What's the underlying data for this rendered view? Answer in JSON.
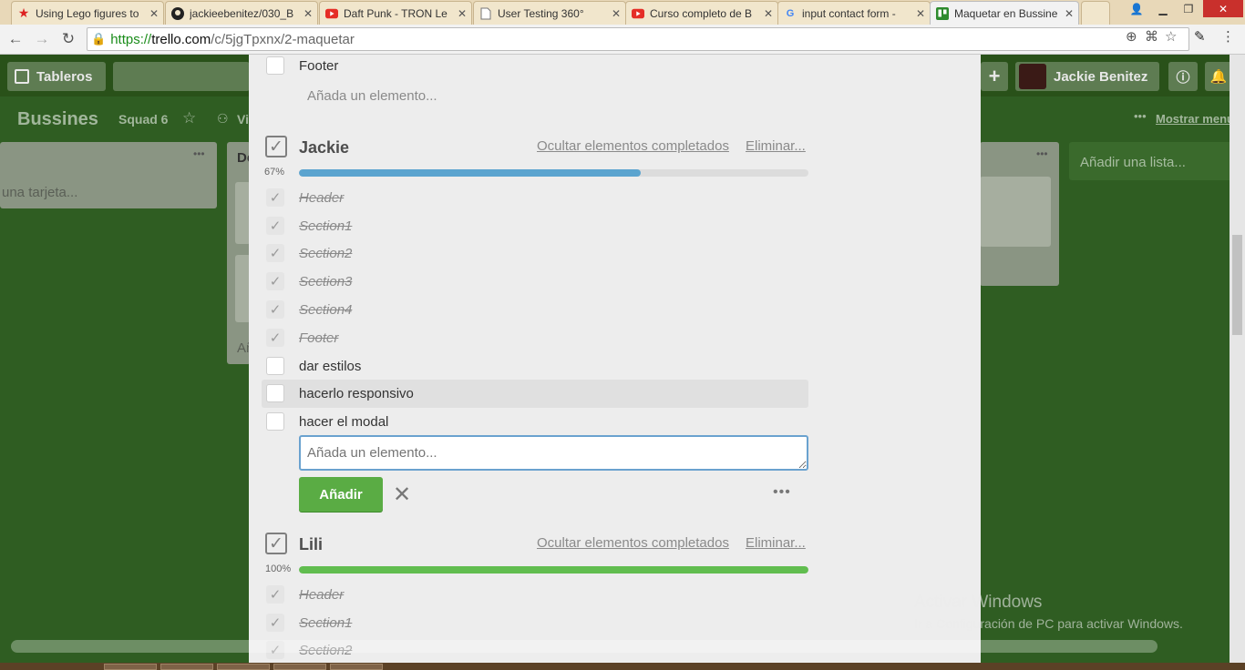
{
  "browser": {
    "tabs": [
      {
        "title": "Using Lego figures to",
        "icon": "star-icon"
      },
      {
        "title": "jackieebenitez/030_B",
        "icon": "github-icon"
      },
      {
        "title": "Daft Punk - TRON Le",
        "icon": "youtube-icon"
      },
      {
        "title": "User Testing 360°",
        "icon": "document-icon"
      },
      {
        "title": "Curso completo de B",
        "icon": "youtube-icon"
      },
      {
        "title": "input contact form -",
        "icon": "google-icon"
      },
      {
        "title": "Maquetar en Bussine",
        "icon": "trello-icon"
      }
    ],
    "url_scheme": "https://",
    "url_host": "trello.com",
    "url_path": "/c/5jgTpxnx/2-maquetar"
  },
  "header": {
    "boards_label": "Tableros",
    "user_name": "Jackie Benitez"
  },
  "board": {
    "title": "Bussines",
    "team": "Squad 6",
    "visibility_short": "Vi",
    "show_menu": "Mostrar menú",
    "add_list": "Añadir una lista...",
    "list_fragment_add_card": "una tarjeta...",
    "list_fragment_title": "De",
    "list_fragment_add": "Añ"
  },
  "modal": {
    "top_item": "Footer",
    "top_add_item": "Añada un elemento...",
    "checklists": [
      {
        "title": "Jackie",
        "hide_completed": "Ocultar elementos completados",
        "delete": "Eliminar...",
        "progress_label": "67%",
        "progress": 0.67,
        "progress_color": "#5ba4cf",
        "items": [
          {
            "text": "Header",
            "done": true
          },
          {
            "text": "Section1",
            "done": true
          },
          {
            "text": "Section2",
            "done": true
          },
          {
            "text": "Section3",
            "done": true
          },
          {
            "text": "Section4",
            "done": true
          },
          {
            "text": "Footer",
            "done": true
          },
          {
            "text": "dar estilos",
            "done": false
          },
          {
            "text": "hacerlo responsivo",
            "done": false
          },
          {
            "text": "hacer el modal",
            "done": false
          }
        ],
        "add_placeholder": "Añada un elemento...",
        "add_button": "Añadir"
      },
      {
        "title": "Lili",
        "hide_completed": "Ocultar elementos completados",
        "delete": "Eliminar...",
        "progress_label": "100%",
        "progress": 1.0,
        "progress_color": "#61bd4f",
        "items": [
          {
            "text": "Header",
            "done": true
          },
          {
            "text": "Section1",
            "done": true
          },
          {
            "text": "Section2",
            "done": true
          }
        ]
      }
    ]
  },
  "overlay": {
    "activate_title": "Activar Windows",
    "activate_sub": "Ir a Configuración de PC para activar Windows."
  },
  "colors": {
    "board_bg": "#2f5d22",
    "add_button": "#5aac44",
    "input_border": "#6aa2cf"
  }
}
